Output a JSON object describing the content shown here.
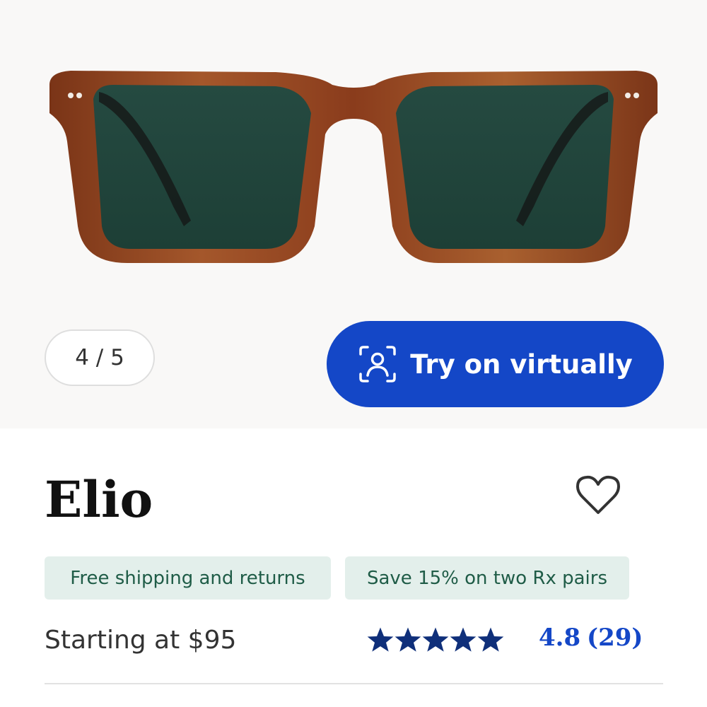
{
  "gallery": {
    "counter": "4 / 5",
    "try_on_label": "Try on virtually",
    "try_on_icon": "face-scan-icon"
  },
  "product": {
    "name": "Elio",
    "favorite_icon": "heart-outline-icon",
    "badges": [
      "Free shipping and returns",
      "Save 15% on two Rx pairs"
    ],
    "price_text": "Starting at $95",
    "rating_value": "4.8",
    "review_count": "(29)",
    "stars_filled": 5
  },
  "colors": {
    "primary_blue": "#1447c7",
    "star_navy": "#0f2f7a",
    "badge_bg": "#e3efeb",
    "badge_text": "#1f5c47",
    "frame_tortoise": "#8a3c1c",
    "lens_green": "#1f433a"
  }
}
